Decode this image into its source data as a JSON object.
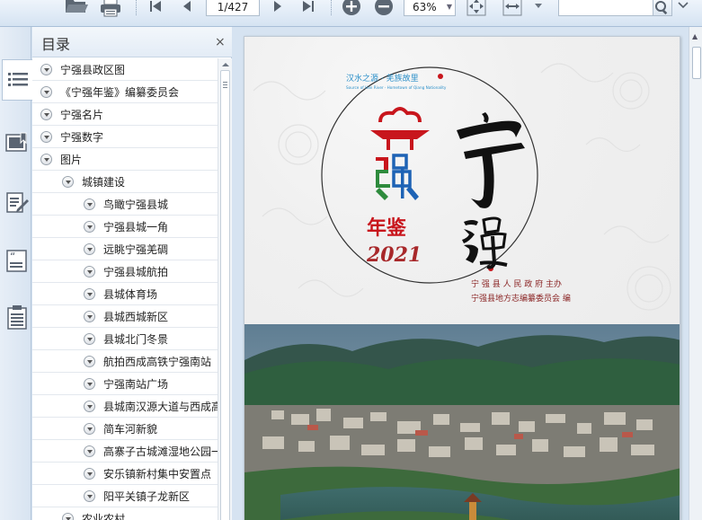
{
  "toolbar": {
    "page_current": "1/427",
    "zoom": "63%",
    "search_value": "",
    "icons": [
      "open-folder-icon",
      "print-icon",
      "first-page-icon",
      "prev-page-icon",
      "next-page-icon",
      "last-page-icon",
      "zoom-in-icon",
      "zoom-out-icon",
      "fit-page-icon",
      "fit-width-icon",
      "dropdown-icon",
      "search-icon",
      "more-icon"
    ]
  },
  "toc": {
    "title": "目录",
    "close": "×",
    "items": [
      {
        "label": "宁强县政区图",
        "level": 0
      },
      {
        "label": "《宁强年鉴》编纂委员会",
        "level": 0
      },
      {
        "label": "宁强名片",
        "level": 0
      },
      {
        "label": "宁强数字",
        "level": 0
      },
      {
        "label": "图片",
        "level": 0
      },
      {
        "label": "城镇建设",
        "level": 1
      },
      {
        "label": "鸟瞰宁强县城",
        "level": 2
      },
      {
        "label": "宁强县城一角",
        "level": 2
      },
      {
        "label": "远眺宁强羌碉",
        "level": 2
      },
      {
        "label": "宁强县城航拍",
        "level": 2
      },
      {
        "label": "县城体育场",
        "level": 2
      },
      {
        "label": "县城西城新区",
        "level": 2
      },
      {
        "label": "县城北门冬景",
        "level": 2
      },
      {
        "label": "航拍西成高铁宁强南站",
        "level": 2
      },
      {
        "label": "宁强南站广场",
        "level": 2
      },
      {
        "label": "县城南汉源大道与西成高",
        "level": 2
      },
      {
        "label": "简车河新貌",
        "level": 2
      },
      {
        "label": "高寨子古城滩湿地公园一",
        "level": 2
      },
      {
        "label": "安乐镇新村集中安置点",
        "level": 2
      },
      {
        "label": "阳平关镇子龙新区",
        "level": 2
      },
      {
        "label": "农业农村",
        "level": 1
      }
    ]
  },
  "cover": {
    "slogan_cn": "汉水之源 · 羌族故里",
    "slogan_en": "Source of Han River · Hometown of Qiang Nationality",
    "title_ning": "宁",
    "title_qiang": "强",
    "logo_char": "强",
    "nianjian": "年鉴",
    "year": "2021",
    "publisher": "宁 强 县 人 民 政 府   主办",
    "editor": "宁强县地方志编纂委员会          编"
  },
  "colors": {
    "accent_red": "#c8161d",
    "brand_green": "#2e8b3d",
    "brand_blue": "#1e63b5",
    "slogan_blue": "#2a8fc9",
    "year_red": "#a8282a",
    "toolbar_icon": "#56606c"
  }
}
